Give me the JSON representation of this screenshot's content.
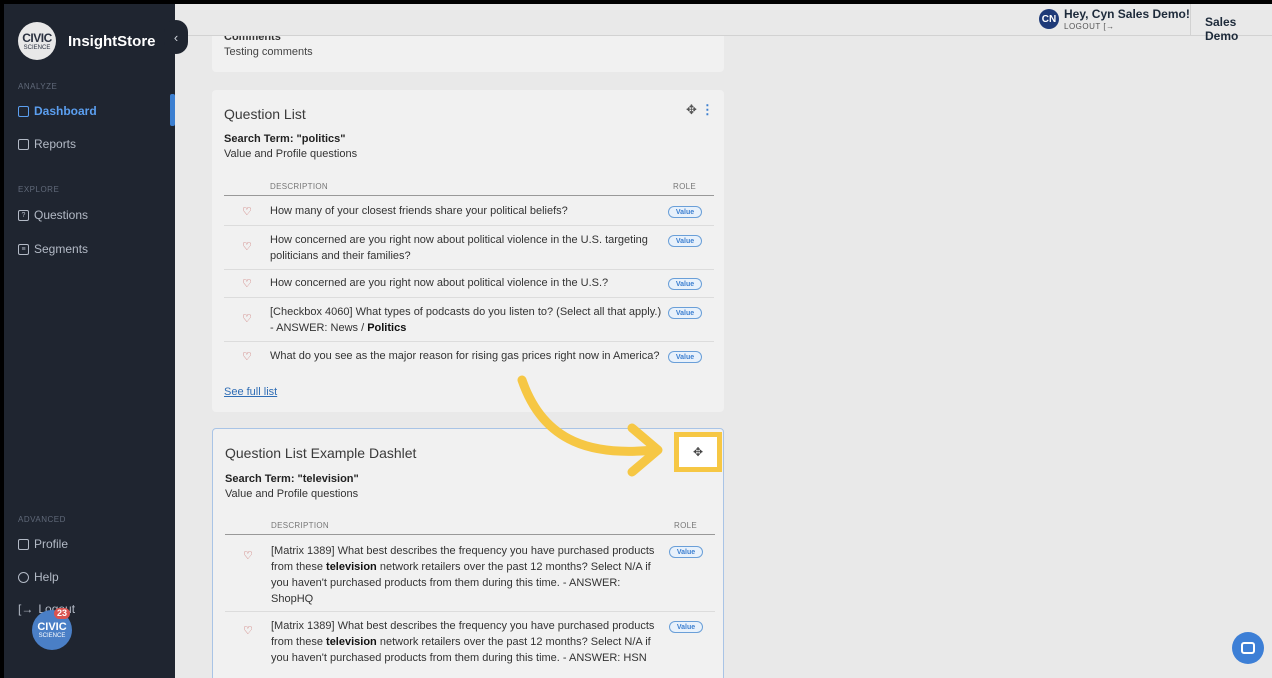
{
  "sidebar": {
    "brand": {
      "logo_line1": "CIVIC",
      "logo_line2": "SCIENCE",
      "name": "InsightStore"
    },
    "sections": {
      "analyze": "ANALYZE",
      "explore": "EXPLORE",
      "advanced": "ADVANCED"
    },
    "items": {
      "dashboard": "Dashboard",
      "reports": "Reports",
      "questions": "Questions",
      "segments": "Segments",
      "profile": "Profile",
      "help": "Help",
      "logout": "Logout"
    },
    "badge": {
      "line1": "CIVIC",
      "line2": "SCIENCE",
      "count": "23"
    }
  },
  "header": {
    "avatar_initials": "CN",
    "greeting": "Hey, Cyn Sales Demo!",
    "logout": "LOGOUT",
    "account": "Sales Demo"
  },
  "comments_card": {
    "title": "Comments",
    "text": "Testing comments"
  },
  "q1": {
    "title": "Question List",
    "search_term": "Search Term: \"politics\"",
    "subtitle": "Value and Profile questions",
    "col_description": "DESCRIPTION",
    "col_role": "ROLE",
    "see_full": "See full list",
    "rows": [
      {
        "text": "How many of your closest friends share your political beliefs?",
        "role": "Value"
      },
      {
        "text": "How concerned are you right now about political violence in the U.S. targeting politicians and their families?",
        "role": "Value"
      },
      {
        "text": "How concerned are you right now about political violence in the U.S.?",
        "role": "Value"
      },
      {
        "text_before": "[Checkbox 4060] What types of podcasts do you listen to? (Select all that apply.) - ANSWER: News / ",
        "text_bold": "Politics",
        "role": "Value"
      },
      {
        "text": "What do you see as the major reason for rising gas prices right now in America?",
        "role": "Value"
      }
    ]
  },
  "q2": {
    "title": "Question List Example Dashlet",
    "search_term": "Search Term: \"television\"",
    "subtitle": "Value and Profile questions",
    "col_description": "DESCRIPTION",
    "col_role": "ROLE",
    "rows": [
      {
        "text_before": "[Matrix 1389] What best describes the frequency you have purchased products from these ",
        "text_bold": "television",
        "text_after": " network retailers over the past 12 months? Select N/A if you haven't purchased products from them during this time. - ANSWER: ShopHQ",
        "role": "Value"
      },
      {
        "text_before": "[Matrix 1389] What best describes the frequency you have purchased products from these ",
        "text_bold": "television",
        "text_after": " network retailers over the past 12 months? Select N/A if you haven't purchased products from them during this time. - ANSWER: HSN",
        "role": "Value"
      }
    ]
  },
  "icons": {
    "move": "move-icon",
    "more": "kebab-menu-icon",
    "heart": "heart-icon",
    "chat": "chat-icon"
  },
  "colors": {
    "sidebar_bg": "#1f2530",
    "accent": "#3c7fd0",
    "highlight": "#f6c744"
  }
}
